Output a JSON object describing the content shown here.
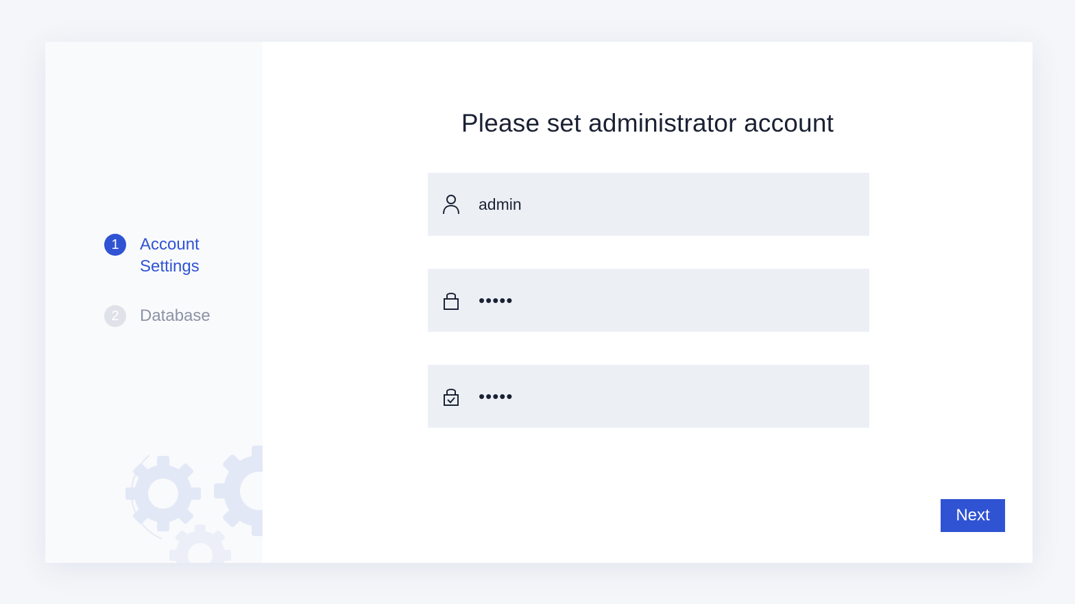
{
  "steps": [
    {
      "number": "1",
      "label": "Account Settings",
      "state": "active"
    },
    {
      "number": "2",
      "label": "Database",
      "state": "inactive"
    }
  ],
  "main": {
    "title": "Please set administrator account"
  },
  "form": {
    "username": {
      "value": "admin",
      "icon": "user-icon"
    },
    "password": {
      "value": "•••••",
      "icon": "lock-icon"
    },
    "confirm_password": {
      "value": "•••••",
      "icon": "lock-check-icon"
    }
  },
  "actions": {
    "next_label": "Next"
  },
  "colors": {
    "accent": "#2f53d3",
    "field_bg": "#ecf0f5",
    "sidebar_bg": "#f9fafc",
    "inactive_step": "#8b93a3"
  }
}
